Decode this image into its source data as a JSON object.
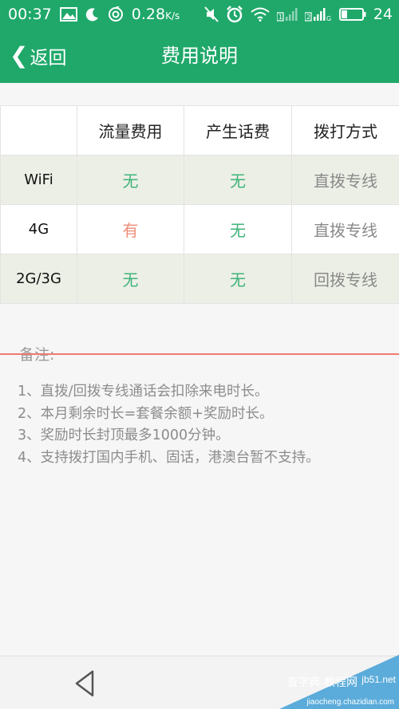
{
  "status_bar": {
    "time": "00:37",
    "data_rate": "0.28",
    "data_rate_unit": "K/s",
    "sim1_label": "1",
    "sim2_label": "2",
    "sim2_network": "G",
    "battery_level": "24",
    "icons": [
      "image-icon",
      "moon-icon",
      "sync-icon",
      "mute-icon",
      "alarm-icon",
      "wifi-icon",
      "signal-icon",
      "battery-icon"
    ]
  },
  "app_bar": {
    "back_label": "返回",
    "title": "费用说明",
    "background_color": "#1fa86a"
  },
  "fee_table": {
    "headers": [
      "",
      "流量费用",
      "产生话费",
      "拨打方式"
    ],
    "rows": [
      {
        "label": "WiFi",
        "data_fee": "无",
        "call_fee": "无",
        "dial_mode": "直拨专线"
      },
      {
        "label": "4G",
        "data_fee": "有",
        "call_fee": "无",
        "dial_mode": "直拨专线"
      },
      {
        "label": "2G/3G",
        "data_fee": "无",
        "call_fee": "无",
        "dial_mode": "回拨专线"
      }
    ],
    "colors": {
      "none": "#3fb47a",
      "has": "#ef8c78",
      "shaded_row": "#ecefe6"
    }
  },
  "notes": {
    "title": "备注:",
    "items": [
      "1、直拨/回拨专线通话会扣除来电时长。",
      "2、本月剩余时长=套餐余额+奖励时长。",
      "3、奖励时长封顶最多1000分钟。",
      "4、支持拨打国内手机、固话，港澳台暂不支持。"
    ]
  },
  "nav_bar": {
    "back_icon": "triangle-back-icon"
  },
  "watermark": {
    "site": "jb51.net",
    "text": "查字典 教程网",
    "url": "jiaocheng.chazidian.com"
  }
}
